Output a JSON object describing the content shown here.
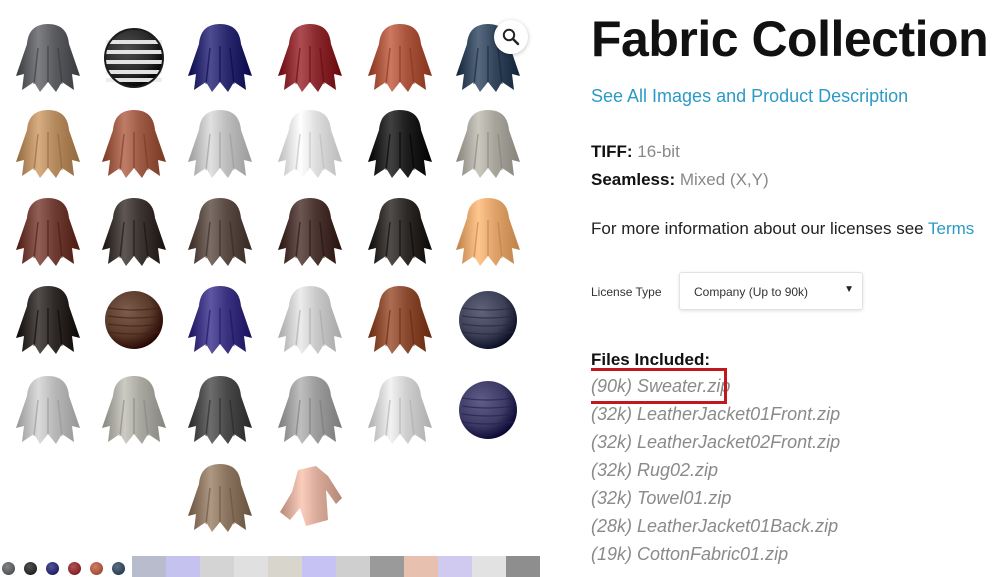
{
  "product": {
    "title": "Fabric Collection",
    "see_all_link": "See All Images and Product Description",
    "specs": [
      {
        "label": "TIFF:",
        "value": "16-bit"
      },
      {
        "label": "Seamless:",
        "value": "Mixed (X,Y)"
      }
    ],
    "license_info": "For more information about our licenses see ",
    "license_link": "Terms",
    "license_type_label": "License Type",
    "license_type_value": "Company (Up to 90k)",
    "files_heading": "Files Included:",
    "files": [
      "(90k) Sweater.zip",
      "(32k) LeatherJacket01Front.zip",
      "(32k) LeatherJacket02Front.zip",
      "(32k) Rug02.zip",
      "(32k) Towel01.zip",
      "(28k) LeatherJacket01Back.zip",
      "(19k) CottonFabric01.zip"
    ],
    "highlighted_file": "(90k) Sweater.zip"
  },
  "gallery": {
    "zoom_icon": "magnifier-icon",
    "thumbnails": [
      {
        "shape": "drape",
        "color": "#5a5c60"
      },
      {
        "shape": "sphere-striped",
        "color": "#2a2a2a"
      },
      {
        "shape": "drape",
        "color": "#2b2a6e"
      },
      {
        "shape": "drape",
        "color": "#8a2a2e"
      },
      {
        "shape": "drape",
        "color": "#a9553e"
      },
      {
        "shape": "drape",
        "color": "#34465c"
      },
      {
        "shape": "drape",
        "color": "#b48a5e"
      },
      {
        "shape": "drape",
        "color": "#9c5a44"
      },
      {
        "shape": "drape",
        "color": "#bdbdbd"
      },
      {
        "shape": "drape",
        "color": "#dddddd"
      },
      {
        "shape": "drape",
        "color": "#1e1e1e"
      },
      {
        "shape": "drape",
        "color": "#a8a59c"
      },
      {
        "shape": "drape",
        "color": "#6e3c33"
      },
      {
        "shape": "drape",
        "color": "#3b3430"
      },
      {
        "shape": "drape",
        "color": "#5a4a44"
      },
      {
        "shape": "drape",
        "color": "#4a3430"
      },
      {
        "shape": "drape",
        "color": "#2e2a28"
      },
      {
        "shape": "drape",
        "color": "#e0a36a"
      },
      {
        "shape": "drape",
        "color": "#2f2a28"
      },
      {
        "shape": "sphere",
        "color": "#5a3a2a"
      },
      {
        "shape": "drape",
        "color": "#3b3380"
      },
      {
        "shape": "drape",
        "color": "#c9c9c9"
      },
      {
        "shape": "drape",
        "color": "#8a4a30"
      },
      {
        "shape": "sphere",
        "color": "#3d4056"
      },
      {
        "shape": "drape",
        "color": "#b8b8b8"
      },
      {
        "shape": "drape",
        "color": "#a9a8a0"
      },
      {
        "shape": "drape",
        "color": "#4a4a4a"
      },
      {
        "shape": "drape",
        "color": "#9c9c9c"
      },
      {
        "shape": "drape",
        "color": "#cfcfcf"
      },
      {
        "shape": "sphere",
        "color": "#3e3a66"
      },
      {
        "shape": "drape",
        "color": "#8c7560"
      },
      {
        "shape": "sweater",
        "color": "#d8aa9a"
      }
    ],
    "strip_thumbs": [
      "#5a5c60",
      "#2a2a2a",
      "#2b2a6e",
      "#8a2a2e",
      "#a9553e",
      "#34465c"
    ],
    "strip_swatches": [
      "#b8bccc",
      "#c6c2f0",
      "#d4d4d4",
      "#e0e0e0",
      "#d8d6cc",
      "#c6c2f4",
      "#cfcfcf",
      "#9a9a9a",
      "#e8c0b0",
      "#d0caf0",
      "#e2e2e2",
      "#8e8e8e"
    ]
  }
}
